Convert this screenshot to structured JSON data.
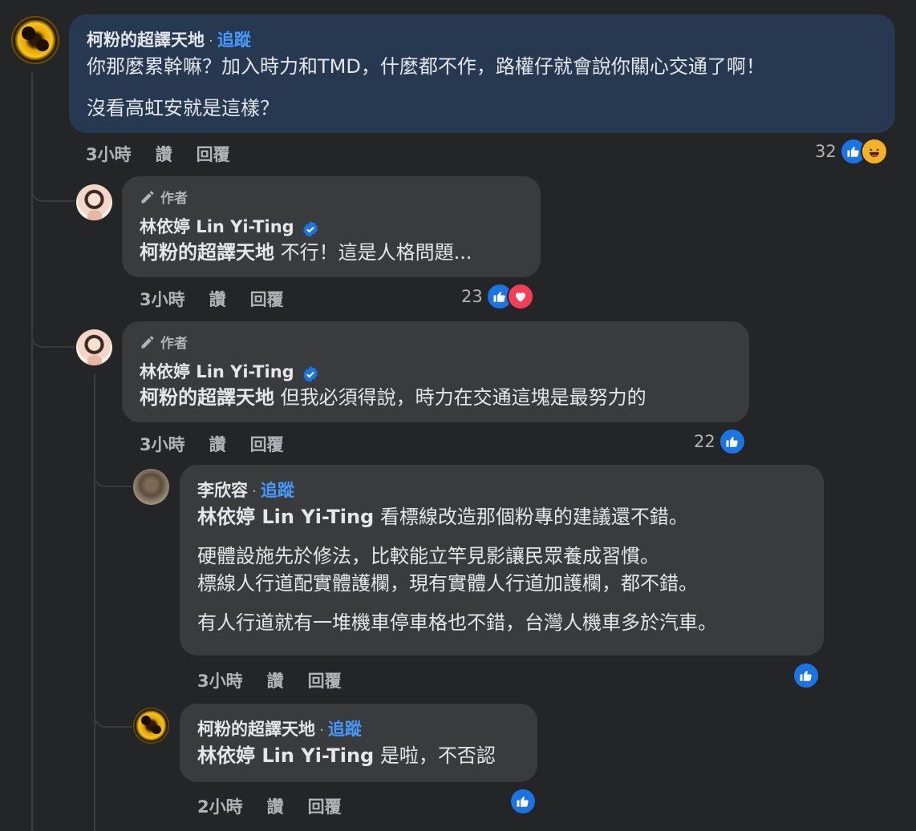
{
  "comments": [
    {
      "author": "柯粉的超譯天地",
      "follow": "追蹤",
      "lines": [
        "你那麼累幹嘛？加入時力和TMD，什麼都不作，路權仔就會說你關心交通了啊！",
        "沒看高虹安就是這樣？"
      ],
      "time": "3小時",
      "like": "讚",
      "reply": "回覆",
      "reaction_count": "32"
    },
    {
      "author_tag": "作者",
      "author": "林依婷 Lin Yi-Ting",
      "mention": "柯粉的超譯天地",
      "text": "不行！這是人格問題...",
      "time": "3小時",
      "like": "讚",
      "reply": "回覆",
      "reaction_count": "23"
    },
    {
      "author_tag": "作者",
      "author": "林依婷 Lin Yi-Ting",
      "mention": "柯粉的超譯天地",
      "text": "但我必須得說，時力在交通這塊是最努力的",
      "time": "3小時",
      "like": "讚",
      "reply": "回覆",
      "reaction_count": "22"
    },
    {
      "author": "李欣容",
      "follow": "追蹤",
      "mention": "林依婷 Lin Yi-Ting",
      "text": "看標線改造那個粉專的建議還不錯。",
      "lines": [
        "硬體設施先於修法，比較能立竿見影讓民眾養成習慣。",
        "標線人行道配實體護欄，現有實體人行道加護欄，都不錯。",
        "有人行道就有一堆機車停車格也不錯，台灣人機車多於汽車。"
      ],
      "time": "3小時",
      "like": "讚",
      "reply": "回覆"
    },
    {
      "author": "柯粉的超譯天地",
      "follow": "追蹤",
      "mention": "林依婷 Lin Yi-Ting",
      "text": "是啦，不否認",
      "time": "2小時",
      "like": "讚",
      "reply": "回覆"
    }
  ],
  "separator": "·",
  "icons": {
    "like": "thumbs-up-icon",
    "love": "heart-icon",
    "haha": "laughing-face-icon",
    "author": "pencil-icon",
    "verified": "verified-badge-icon"
  },
  "colors": {
    "background": "#242526",
    "bubble": "#3a3b3c",
    "highlight_bubble": "#263951",
    "link": "#4599ff",
    "like": "#1b74e4"
  }
}
